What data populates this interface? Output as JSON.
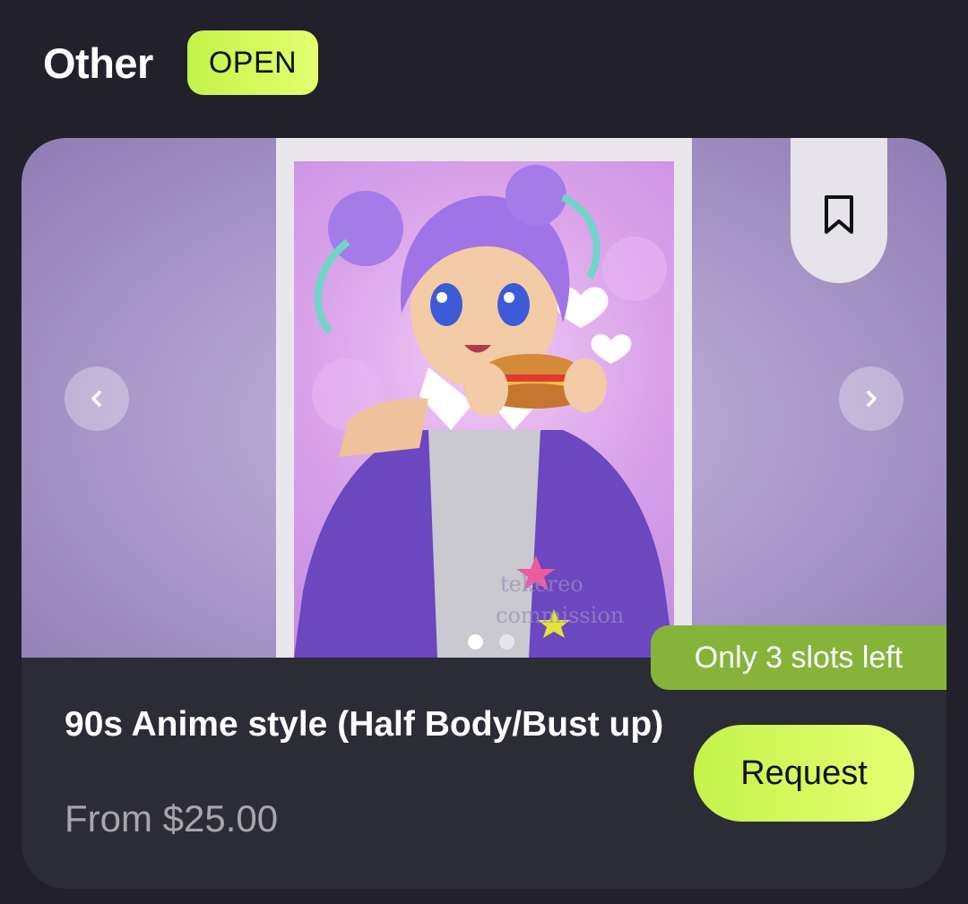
{
  "section": {
    "title": "Other",
    "status": "OPEN"
  },
  "card": {
    "title": "90s Anime style (Half Body/Bust up)",
    "price": "From $25.00",
    "slots_badge": "Only 3 slots left",
    "request_label": "Request",
    "carousel": {
      "total_images": 2,
      "active_index": 0
    },
    "icons": {
      "prev": "chevron-left-icon",
      "next": "chevron-right-icon",
      "bookmark": "bookmark-icon"
    }
  },
  "colors": {
    "background": "#22212b",
    "card": "#2c2c36",
    "accent": "#c4f34a",
    "slots_badge": "#86b43a",
    "price_text": "#a7a6ad"
  }
}
